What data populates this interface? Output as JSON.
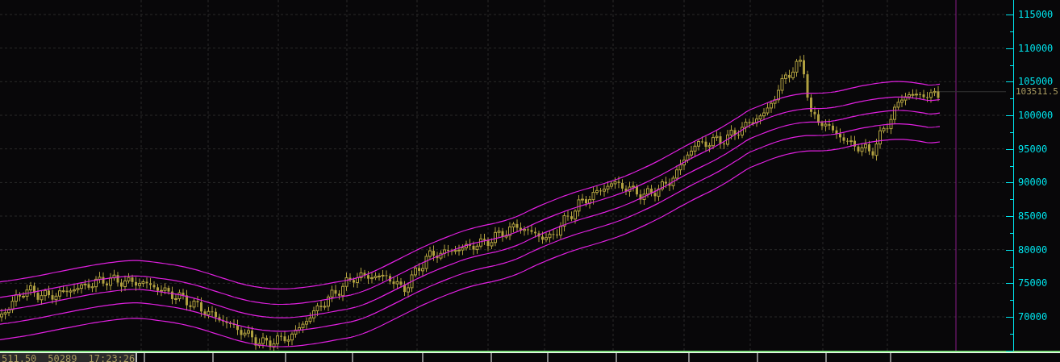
{
  "price_axis": {
    "labels": [
      "115000",
      "110000",
      "105000",
      "100000",
      "95000",
      "90000",
      "85000",
      "80000",
      "75000",
      "70000"
    ],
    "last_price": "103511.5"
  },
  "status_bar": {
    "fields": [
      "511.50",
      "50289",
      "17:23:26"
    ]
  }
}
